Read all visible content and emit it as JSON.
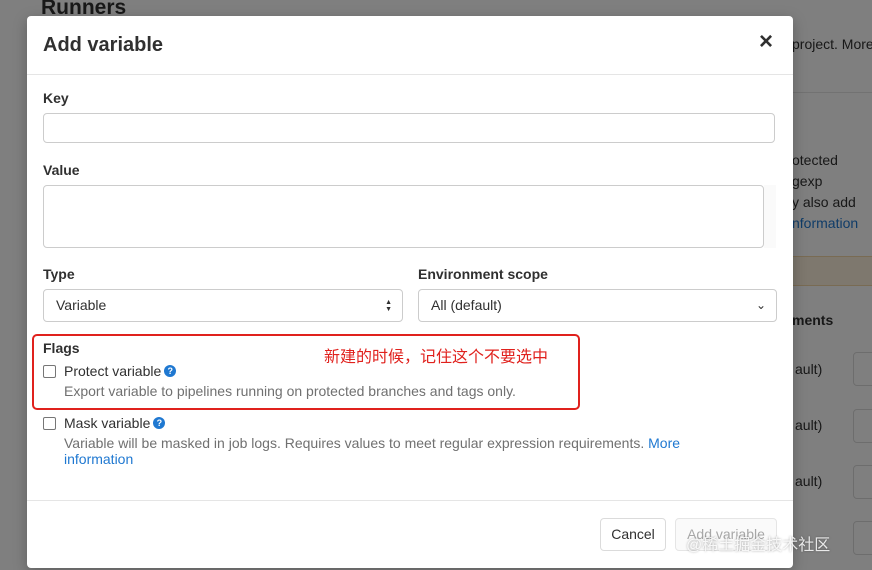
{
  "background": {
    "page_title": "Runners",
    "lines": [
      "project. More",
      "otected",
      "gexp",
      "y also add",
      "nformation"
    ],
    "environments_header": "ments",
    "row_scope": "ault)"
  },
  "modal": {
    "title": "Add variable",
    "close_icon": "×",
    "key_label": "Key",
    "key_value": "",
    "value_label": "Value",
    "value_value": "",
    "type_label": "Type",
    "type_selected": "Variable",
    "env_label": "Environment scope",
    "env_selected": "All (default)",
    "flags_label": "Flags",
    "protect": {
      "label": "Protect variable",
      "checked": false,
      "help": "Export variable to pipelines running on protected branches and tags only."
    },
    "mask": {
      "label": "Mask variable",
      "checked": false,
      "help": "Variable will be masked in job logs. Requires values to meet regular expression requirements.",
      "more": "More",
      "information": "information"
    },
    "cancel_label": "Cancel",
    "add_label": "Add variable"
  },
  "annotation": "新建的时候，记住这个不要选中",
  "watermark": "@稀土掘金技术社区"
}
